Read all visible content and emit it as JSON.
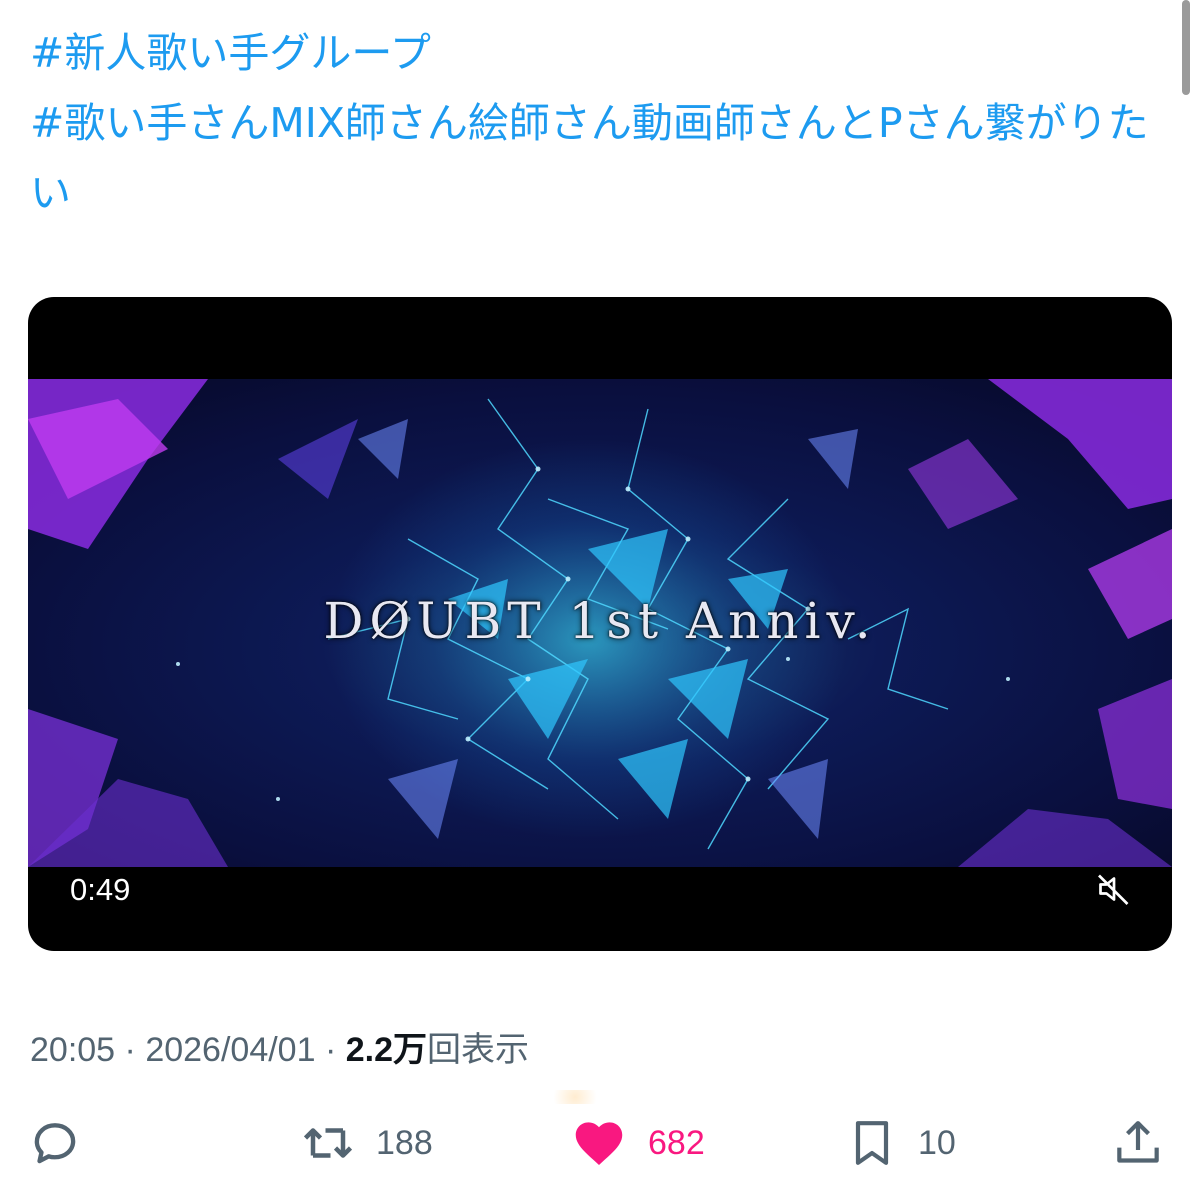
{
  "post": {
    "hashtags": [
      "#新人歌い手グループ",
      "#歌い手さんMIX師さん絵師さん動画師さんとPさん繋がりたい"
    ]
  },
  "video": {
    "title": "DØUBT 1st Anniv.",
    "duration": "0:49",
    "muted": true
  },
  "meta": {
    "time": "20:05",
    "separator": "·",
    "date": "2026/04/01",
    "views": "2.2万",
    "views_label": "回表示"
  },
  "actions": {
    "reply_icon": "speech-bubble-icon",
    "retweets": "188",
    "likes": "682",
    "liked": true,
    "bookmarks": "10"
  },
  "colors": {
    "link": "#1d9bf0",
    "meta_text": "#536471",
    "like": "#f91880"
  }
}
